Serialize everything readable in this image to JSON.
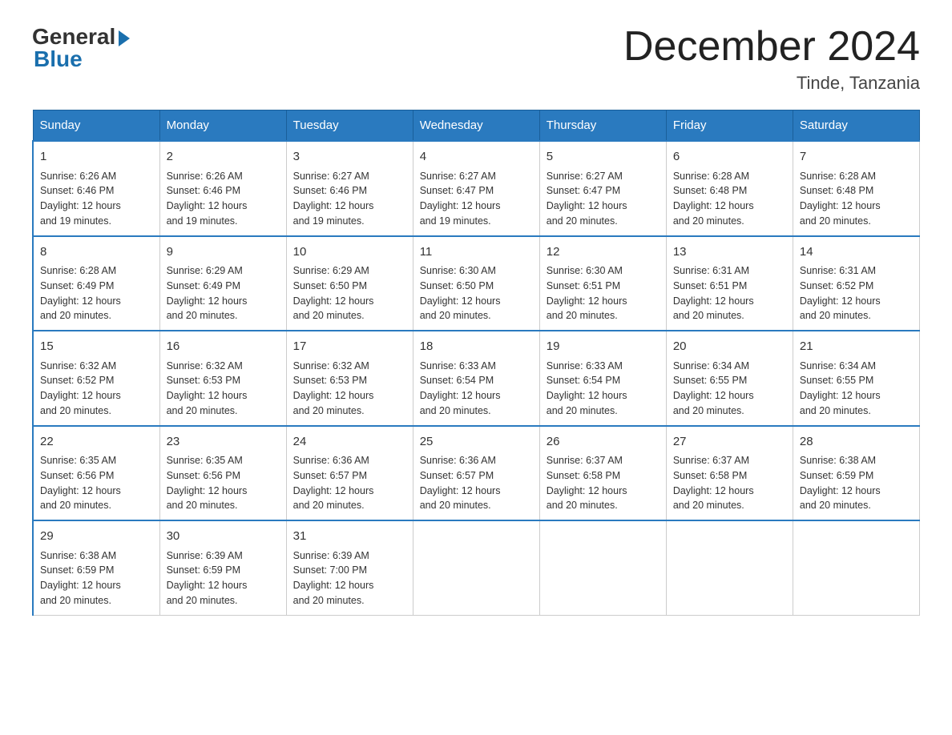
{
  "logo": {
    "general": "General",
    "blue": "Blue"
  },
  "title": "December 2024",
  "location": "Tinde, Tanzania",
  "days_of_week": [
    "Sunday",
    "Monday",
    "Tuesday",
    "Wednesday",
    "Thursday",
    "Friday",
    "Saturday"
  ],
  "weeks": [
    [
      {
        "day": "1",
        "sunrise": "6:26 AM",
        "sunset": "6:46 PM",
        "daylight": "12 hours and 19 minutes."
      },
      {
        "day": "2",
        "sunrise": "6:26 AM",
        "sunset": "6:46 PM",
        "daylight": "12 hours and 19 minutes."
      },
      {
        "day": "3",
        "sunrise": "6:27 AM",
        "sunset": "6:46 PM",
        "daylight": "12 hours and 19 minutes."
      },
      {
        "day": "4",
        "sunrise": "6:27 AM",
        "sunset": "6:47 PM",
        "daylight": "12 hours and 19 minutes."
      },
      {
        "day": "5",
        "sunrise": "6:27 AM",
        "sunset": "6:47 PM",
        "daylight": "12 hours and 20 minutes."
      },
      {
        "day": "6",
        "sunrise": "6:28 AM",
        "sunset": "6:48 PM",
        "daylight": "12 hours and 20 minutes."
      },
      {
        "day": "7",
        "sunrise": "6:28 AM",
        "sunset": "6:48 PM",
        "daylight": "12 hours and 20 minutes."
      }
    ],
    [
      {
        "day": "8",
        "sunrise": "6:28 AM",
        "sunset": "6:49 PM",
        "daylight": "12 hours and 20 minutes."
      },
      {
        "day": "9",
        "sunrise": "6:29 AM",
        "sunset": "6:49 PM",
        "daylight": "12 hours and 20 minutes."
      },
      {
        "day": "10",
        "sunrise": "6:29 AM",
        "sunset": "6:50 PM",
        "daylight": "12 hours and 20 minutes."
      },
      {
        "day": "11",
        "sunrise": "6:30 AM",
        "sunset": "6:50 PM",
        "daylight": "12 hours and 20 minutes."
      },
      {
        "day": "12",
        "sunrise": "6:30 AM",
        "sunset": "6:51 PM",
        "daylight": "12 hours and 20 minutes."
      },
      {
        "day": "13",
        "sunrise": "6:31 AM",
        "sunset": "6:51 PM",
        "daylight": "12 hours and 20 minutes."
      },
      {
        "day": "14",
        "sunrise": "6:31 AM",
        "sunset": "6:52 PM",
        "daylight": "12 hours and 20 minutes."
      }
    ],
    [
      {
        "day": "15",
        "sunrise": "6:32 AM",
        "sunset": "6:52 PM",
        "daylight": "12 hours and 20 minutes."
      },
      {
        "day": "16",
        "sunrise": "6:32 AM",
        "sunset": "6:53 PM",
        "daylight": "12 hours and 20 minutes."
      },
      {
        "day": "17",
        "sunrise": "6:32 AM",
        "sunset": "6:53 PM",
        "daylight": "12 hours and 20 minutes."
      },
      {
        "day": "18",
        "sunrise": "6:33 AM",
        "sunset": "6:54 PM",
        "daylight": "12 hours and 20 minutes."
      },
      {
        "day": "19",
        "sunrise": "6:33 AM",
        "sunset": "6:54 PM",
        "daylight": "12 hours and 20 minutes."
      },
      {
        "day": "20",
        "sunrise": "6:34 AM",
        "sunset": "6:55 PM",
        "daylight": "12 hours and 20 minutes."
      },
      {
        "day": "21",
        "sunrise": "6:34 AM",
        "sunset": "6:55 PM",
        "daylight": "12 hours and 20 minutes."
      }
    ],
    [
      {
        "day": "22",
        "sunrise": "6:35 AM",
        "sunset": "6:56 PM",
        "daylight": "12 hours and 20 minutes."
      },
      {
        "day": "23",
        "sunrise": "6:35 AM",
        "sunset": "6:56 PM",
        "daylight": "12 hours and 20 minutes."
      },
      {
        "day": "24",
        "sunrise": "6:36 AM",
        "sunset": "6:57 PM",
        "daylight": "12 hours and 20 minutes."
      },
      {
        "day": "25",
        "sunrise": "6:36 AM",
        "sunset": "6:57 PM",
        "daylight": "12 hours and 20 minutes."
      },
      {
        "day": "26",
        "sunrise": "6:37 AM",
        "sunset": "6:58 PM",
        "daylight": "12 hours and 20 minutes."
      },
      {
        "day": "27",
        "sunrise": "6:37 AM",
        "sunset": "6:58 PM",
        "daylight": "12 hours and 20 minutes."
      },
      {
        "day": "28",
        "sunrise": "6:38 AM",
        "sunset": "6:59 PM",
        "daylight": "12 hours and 20 minutes."
      }
    ],
    [
      {
        "day": "29",
        "sunrise": "6:38 AM",
        "sunset": "6:59 PM",
        "daylight": "12 hours and 20 minutes."
      },
      {
        "day": "30",
        "sunrise": "6:39 AM",
        "sunset": "6:59 PM",
        "daylight": "12 hours and 20 minutes."
      },
      {
        "day": "31",
        "sunrise": "6:39 AM",
        "sunset": "7:00 PM",
        "daylight": "12 hours and 20 minutes."
      },
      null,
      null,
      null,
      null
    ]
  ]
}
